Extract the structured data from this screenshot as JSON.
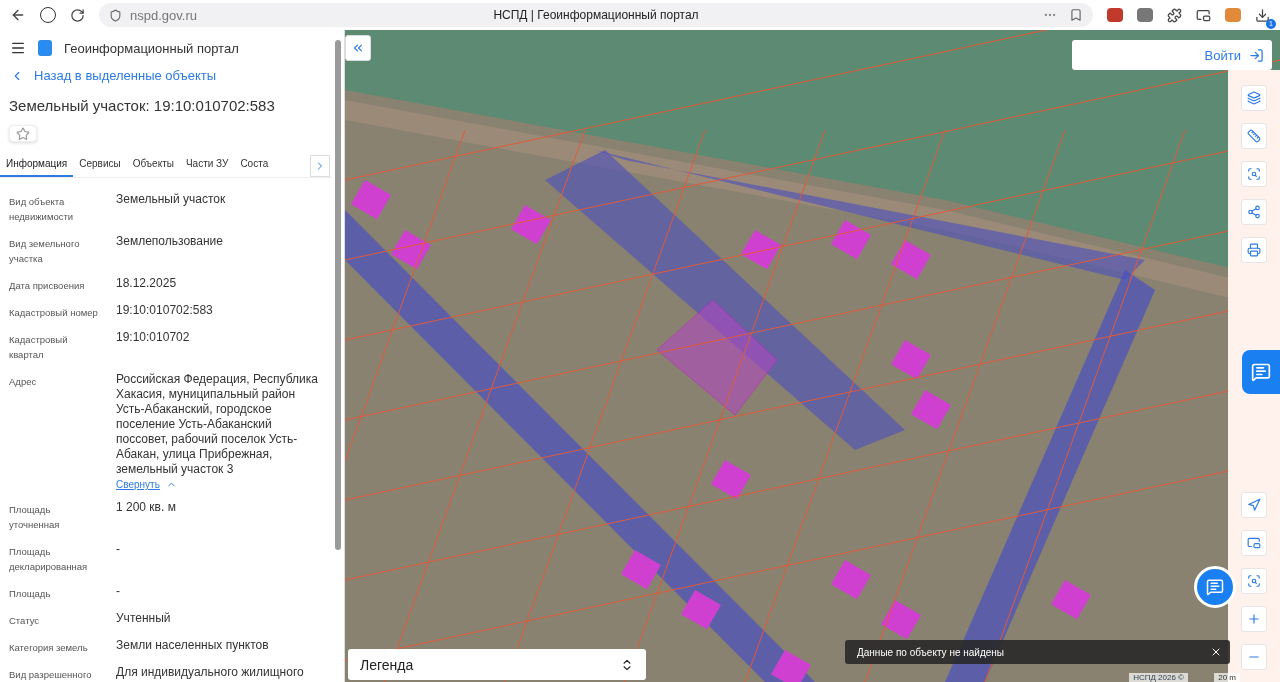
{
  "browser": {
    "url": "nspd.gov.ru",
    "tab_title": "НСПД | Геоинформационный портал",
    "download_badge": "1"
  },
  "header": {
    "title": "Геоинформационный портал"
  },
  "back_link": "Назад в выделенные объекты",
  "object_title": "Земельный участок: 19:10:010702:583",
  "favorite": {
    "selected": false
  },
  "tabs": [
    {
      "label": "Информация",
      "selected": true
    },
    {
      "label": "Сервисы",
      "selected": false
    },
    {
      "label": "Объекты",
      "selected": false
    },
    {
      "label": "Части ЗУ",
      "selected": false
    },
    {
      "label": "Соста",
      "selected": false
    }
  ],
  "fields": [
    {
      "label": "Вид объекта недвижимости",
      "value": "Земельный участок"
    },
    {
      "label": "Вид земельного участка",
      "value": "Землепользование"
    },
    {
      "label": "Дата присвоения",
      "value": "18.12.2025"
    },
    {
      "label": "Кадастровый номер",
      "value": "19:10:010702:583"
    },
    {
      "label": "Кадастровый квартал",
      "value": "19:10:010702"
    },
    {
      "label": "Адрес",
      "value": "Российская Федерация, Республика Хакасия, муниципальный район Усть-Абаканский, городское поселение Усть-Абаканский поссовет, рабочий поселок Усть-Абакан, улица Прибрежная, земельный участок 3",
      "link": "Свернуть"
    },
    {
      "label": "Площадь уточненная",
      "value": "1 200 кв. м"
    },
    {
      "label": "Площадь декларированная",
      "value": "-"
    },
    {
      "label": "Площадь",
      "value": "-"
    },
    {
      "label": "Статус",
      "value": "Учтенный"
    },
    {
      "label": "Категория земель",
      "value": "Земли населенных пунктов"
    },
    {
      "label": "Вид разрешенного",
      "value": "Для индивидуального жилищного"
    }
  ],
  "login_button": "Войти",
  "legend": "Легенда",
  "toast": {
    "message": "Данные по объекту не найдены"
  },
  "attribution": "НСПД 2026 ©",
  "scale": "20 m"
}
